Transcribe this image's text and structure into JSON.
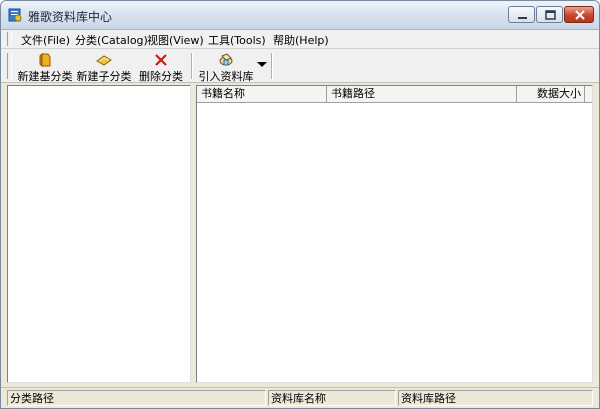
{
  "window": {
    "title": "雅歌资料库中心",
    "icon": "app-book-icon"
  },
  "menu": [
    {
      "label": "文件(File)"
    },
    {
      "label": "分类(Catalog)"
    },
    {
      "label": "视图(View)"
    },
    {
      "label": "工具(Tools)"
    },
    {
      "label": "帮助(Help)"
    }
  ],
  "toolbar": {
    "buttons": [
      {
        "label": "新建基分类",
        "icon": "new-root-category-icon"
      },
      {
        "label": "新建子分类",
        "icon": "new-subcategory-icon"
      },
      {
        "label": "删除分类",
        "icon": "delete-icon"
      },
      {
        "label": "引入资料库",
        "icon": "import-library-icon"
      }
    ]
  },
  "list": {
    "columns": [
      {
        "label": "书籍名称"
      },
      {
        "label": "书籍路径"
      },
      {
        "label": "数据大小"
      }
    ]
  },
  "status": {
    "panels": [
      {
        "label": "分类路径"
      },
      {
        "label": "资料库名称"
      },
      {
        "label": "资料库路径"
      }
    ]
  },
  "colors": {
    "close_button": "#c8442c",
    "titlebar": "#dae4f0"
  }
}
